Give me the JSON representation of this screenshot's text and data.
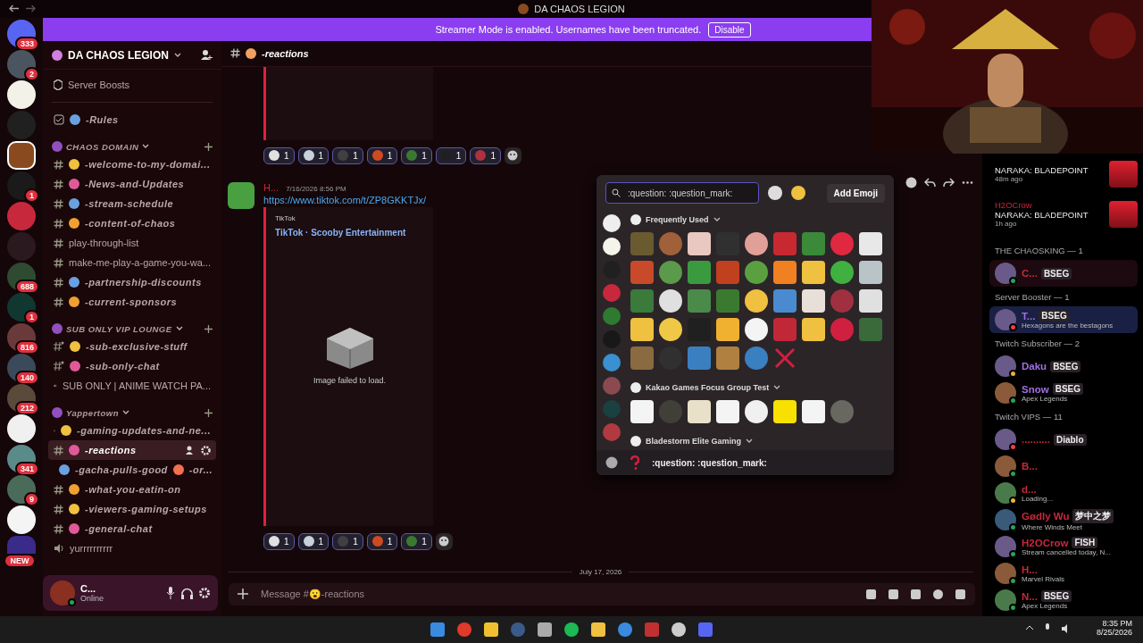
{
  "window": {
    "title": "DA CHAOS LEGION"
  },
  "banner": {
    "text": "Streamer Mode is enabled. Usernames have been truncated.",
    "button": "Disable"
  },
  "servers": [
    {
      "color": "#5865f2",
      "badge": "333",
      "selected": false
    },
    {
      "color": "#4a5560",
      "badge": "2",
      "selected": false
    },
    {
      "color": "#f2f2e8",
      "selected": false
    },
    {
      "color": "#202020",
      "selected": false
    },
    {
      "color": "#8a4a20",
      "selected": true
    },
    {
      "color": "#1a1a1a",
      "badge": "1",
      "selected": false
    },
    {
      "color": "#c8283c",
      "selected": false
    },
    {
      "color": "#2a1a20",
      "selected": false
    },
    {
      "color": "#2e4a30",
      "badge": "688",
      "selected": false
    },
    {
      "color": "#103830",
      "badge": "1",
      "selected": false
    },
    {
      "color": "#6a3a3a",
      "badge": "816",
      "selected": false
    },
    {
      "color": "#3a4a5a",
      "badge": "140",
      "selected": false
    },
    {
      "color": "#5a4a3a",
      "badge": "212",
      "selected": false
    },
    {
      "color": "#f0f0f0",
      "selected": false
    },
    {
      "color": "#5a8a8a",
      "badge": "341",
      "selected": false
    },
    {
      "color": "#4a6a5a",
      "badge": "9",
      "selected": false
    },
    {
      "color": "#f4f4f4",
      "selected": false
    },
    {
      "color": "#3a2a8a",
      "badge": "NEW",
      "selected": false
    }
  ],
  "sidebar": {
    "server_name": "DA CHAOS LEGION",
    "boosts": "Server Boosts",
    "rules": "-Rules",
    "categories": [
      {
        "name": "CHAOS DOMAIN",
        "channels": [
          {
            "kind": "fancy",
            "name": "-welcome-to-my-domai...",
            "selected": false
          },
          {
            "kind": "fancy",
            "name": "-News-and-Updates",
            "selected": false
          },
          {
            "kind": "fancy",
            "name": "-stream-schedule",
            "selected": false
          },
          {
            "kind": "fancy",
            "name": "-content-of-chaos",
            "selected": false
          },
          {
            "kind": "plain",
            "name": "play-through-list",
            "selected": false
          },
          {
            "kind": "plain",
            "name": "make-me-play-a-game-you-wa...",
            "selected": false
          },
          {
            "kind": "fancy",
            "name": "-partnership-discounts",
            "selected": false
          },
          {
            "kind": "fancy",
            "name": "-current-sponsors",
            "selected": false
          }
        ]
      },
      {
        "name": "SUB ONLY VIP LOUNGE",
        "channels": [
          {
            "kind": "locked",
            "name": "-sub-exclusive-stuff",
            "selected": false
          },
          {
            "kind": "locked",
            "name": "-sub-only-chat",
            "selected": false
          },
          {
            "kind": "voice",
            "name": "SUB ONLY | ANIME WATCH PA...",
            "selected": false
          }
        ]
      },
      {
        "name": "Yappertown",
        "channels": [
          {
            "kind": "fancy",
            "name": "-gaming-updates-and-ne...",
            "selected": false
          },
          {
            "kind": "fancy",
            "name": "-reactions",
            "selected": true
          },
          {
            "kind": "fancy",
            "name": "-gacha-pulls-good",
            "suffix": "-or...",
            "selected": false
          },
          {
            "kind": "fancy",
            "name": "-what-you-eatin-on",
            "selected": false
          },
          {
            "kind": "fancy",
            "name": "-viewers-gaming-setups",
            "selected": false
          },
          {
            "kind": "fancy",
            "name": "-general-chat",
            "selected": false
          },
          {
            "kind": "voice",
            "name": "yurrrrrrrrrr",
            "selected": false
          }
        ]
      }
    ],
    "user": {
      "name": "C...",
      "status": "Online"
    }
  },
  "channel_header": {
    "name": "-reactions"
  },
  "messages": [
    {
      "reactions": [
        {
          "color": "#e0e0e0",
          "count": "1"
        },
        {
          "color": "#c8d0d8",
          "count": "1"
        },
        {
          "color": "#404040",
          "count": "1"
        },
        {
          "color": "#d04a20",
          "count": "1"
        },
        {
          "color": "#3a7a30",
          "count": "1"
        },
        {
          "color": "#202020",
          "count": "1"
        },
        {
          "color": "#b03040",
          "count": "1"
        }
      ]
    },
    {
      "author": "H...",
      "time": "7/16/2026 8:56 PM",
      "link": "https://www.tiktok.com/t/ZP8GKKTJx/",
      "embed": {
        "provider": "TikTok",
        "title": "TikTok · Scooby Entertainment",
        "image_error": "Image failed to load."
      },
      "reactions": [
        {
          "color": "#e0e0e0",
          "count": "1"
        },
        {
          "color": "#c8d0d8",
          "count": "1"
        },
        {
          "color": "#404040",
          "count": "1"
        },
        {
          "color": "#d04a20",
          "count": "1"
        },
        {
          "color": "#3a7a30",
          "count": "1"
        }
      ]
    }
  ],
  "date_divider": "July 17, 2026",
  "composer": {
    "placeholder": "Message #😮-reactions"
  },
  "emoji_picker": {
    "search": ":question: :question_mark:",
    "add_button": "Add Emoji",
    "sections": [
      {
        "title": "Frequently Used",
        "items": [
          {
            "color": "#6a5a30"
          },
          {
            "color": "#a0603a"
          },
          {
            "color": "#e8c8c0"
          },
          {
            "color": "#303030"
          },
          {
            "color": "#e0a098"
          },
          {
            "color": "#c82830"
          },
          {
            "color": "#3a8a3a"
          },
          {
            "color": "#e02840"
          },
          {
            "color": "#e8e8e8"
          },
          {
            "color": "#c84a2a"
          },
          {
            "color": "#5a9a4a"
          },
          {
            "color": "#3a9a40"
          },
          {
            "color": "#c04020"
          },
          {
            "color": "#5aa040"
          },
          {
            "color": "#f08020"
          },
          {
            "color": "#f0c040"
          },
          {
            "color": "#40b040"
          },
          {
            "color": "#b8c4c8"
          },
          {
            "color": "#3a7a3a"
          },
          {
            "color": "#e0e0e0"
          },
          {
            "color": "#4a8a4a"
          },
          {
            "color": "#3a7a30"
          },
          {
            "color": "#f0c040"
          },
          {
            "color": "#4a8ad0"
          },
          {
            "color": "#e8e0d8"
          },
          {
            "color": "#a03040"
          },
          {
            "color": "#e0e0e0"
          },
          {
            "color": "#f0c040"
          },
          {
            "color": "#f0c848"
          },
          {
            "color": "#202020"
          },
          {
            "color": "#f0b030"
          },
          {
            "color": "#f4f4f4"
          },
          {
            "color": "#c02838"
          },
          {
            "color": "#f0c040"
          },
          {
            "color": "#d02040"
          },
          {
            "color": "#3a6a3a"
          },
          {
            "color": "#8a6a40"
          },
          {
            "color": "#303030"
          },
          {
            "color": "#3a80c0"
          },
          {
            "color": "#b08040"
          },
          {
            "color": "#3a80c0"
          }
        ],
        "x_mark": true
      },
      {
        "title": "Kakao Games Focus Group Test",
        "items": [
          {
            "color": "#f4f4f4"
          },
          {
            "color": "#404038"
          },
          {
            "color": "#e8e0c8"
          },
          {
            "color": "#f4f4f4"
          },
          {
            "color": "#f0f0f0"
          },
          {
            "color": "#f8e000"
          },
          {
            "color": "#f4f4f4"
          },
          {
            "color": "#686860"
          }
        ],
        "x_mark": false
      },
      {
        "title": "Bladestorm Elite Gaming",
        "x_mark": false
      }
    ],
    "preview": ":question: :question_mark:"
  },
  "members": {
    "activities": [
      {
        "game": "NARAKA: BLADEPOINT",
        "time": "48m ago"
      },
      {
        "name": "H2OCrow",
        "game": "NARAKA: BLADEPOINT",
        "time": "1h ago"
      }
    ],
    "groups": [
      {
        "title": "THE CHAOSKING — 1",
        "members": [
          {
            "name": "C...",
            "color": "#c8283c",
            "tag": "BSEG",
            "status_dot": {
              "color": "#23a55a"
            }
          }
        ]
      },
      {
        "title": "Server Booster — 1",
        "members": [
          {
            "name": "T...",
            "color": "#a070e0",
            "tag": "BSEG",
            "status": "Hexagons are the bestagons",
            "status_dot": {
              "color": "#f23f43"
            }
          }
        ]
      },
      {
        "title": "Twitch Subscriber — 2",
        "members": [
          {
            "name": "Daku",
            "color": "#a070e0",
            "tag": "BSEG",
            "status_dot": {
              "color": "#f0b232"
            }
          },
          {
            "name": "Snow",
            "color": "#a070e0",
            "tag": "BSEG",
            "status": "Apex Legends",
            "status_dot": {
              "color": "#23a55a"
            }
          }
        ]
      },
      {
        "title": "Twitch VIPS — 11",
        "members": [
          {
            "name": "..........",
            "color": "#c8283c",
            "tag": "Diablo",
            "status_dot": {
              "color": "#f23f43"
            }
          },
          {
            "name": "B...",
            "color": "#c8283c",
            "status_dot": {
              "color": "#23a55a"
            }
          },
          {
            "name": "d...",
            "color": "#c8283c",
            "status": "Loading...",
            "status_dot": {
              "color": "#f0b232"
            }
          },
          {
            "name": "Gødly Wu",
            "color": "#c8283c",
            "tag": "梦中之梦",
            "status": "Where Winds Meet",
            "status_dot": {
              "color": "#23a55a"
            }
          },
          {
            "name": "H2OCrow",
            "color": "#c8283c",
            "tag": "FISH",
            "status": "Stream cancelled today, N...",
            "status_dot": {
              "color": "#23a55a"
            }
          },
          {
            "name": "H...",
            "color": "#c8283c",
            "status": "Marvel Rivals",
            "status_dot": {
              "color": "#23a55a"
            }
          },
          {
            "name": "N...",
            "color": "#c8283c",
            "tag": "BSEG",
            "status": "Apex Legends",
            "status_dot": {
              "color": "#23a55a"
            }
          }
        ]
      }
    ]
  },
  "taskbar": {
    "time": "8:35 PM",
    "date": "8/25/2026"
  }
}
